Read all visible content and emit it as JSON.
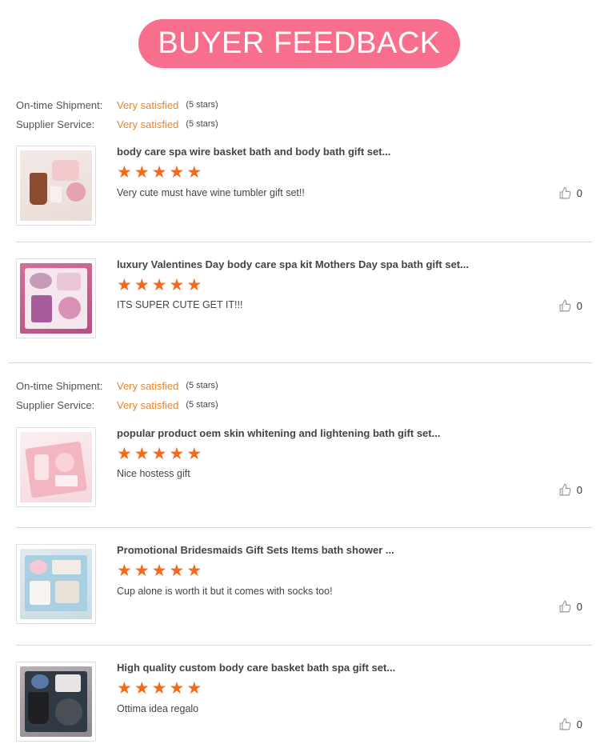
{
  "header": {
    "title": "BUYER FEEDBACK"
  },
  "seller_ratings": {
    "shipment_label": "On-time Shipment:",
    "service_label": "Supplier Service:",
    "value": "Very satisfied",
    "stars_text": "(5 stars)"
  },
  "colors": {
    "banner": "#f76f8c",
    "accent_orange": "#e8842a",
    "star": "#f26a1b"
  },
  "reviews": [
    {
      "title": "body care spa wire basket bath and body bath gift set...",
      "rating": 5,
      "comment": "Very cute must have wine tumbler gift set!!",
      "likes": "0",
      "like_icon": "thumbs-up-icon"
    },
    {
      "title": "luxury Valentines Day body care spa kit Mothers Day spa bath gift set...",
      "rating": 5,
      "comment": "ITS SUPER CUTE GET IT!!!",
      "likes": "0",
      "like_icon": "thumbs-up-icon"
    },
    {
      "title": "popular product oem skin whitening and lightening bath gift set...",
      "rating": 5,
      "comment": "Nice hostess gift",
      "likes": "0",
      "like_icon": "thumbs-up-icon"
    },
    {
      "title": "Promotional Bridesmaids Gift Sets Items bath shower  ...",
      "rating": 5,
      "comment": "Cup alone is worth it but it comes with socks too!",
      "likes": "0",
      "like_icon": "thumbs-up-icon"
    },
    {
      "title": "High quality custom body care basket bath spa gift set...",
      "rating": 5,
      "comment": "Ottima idea regalo",
      "likes": "0",
      "like_icon": "thumbs-up-icon"
    }
  ]
}
